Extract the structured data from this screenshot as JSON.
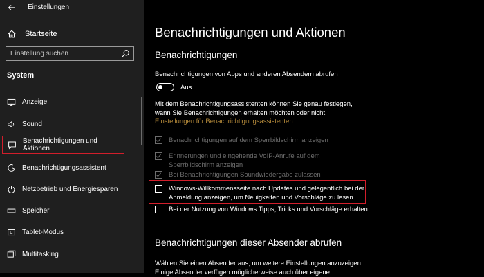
{
  "window": {
    "title": "Einstellungen",
    "back_icon": "back-arrow-icon"
  },
  "sidebar": {
    "home_label": "Startseite",
    "search_placeholder": "Einstellung suchen",
    "section": "System",
    "items": [
      {
        "label": "Anzeige",
        "icon": "monitor-icon"
      },
      {
        "label": "Sound",
        "icon": "speaker-icon"
      },
      {
        "label": "Benachrichtigungen und Aktionen",
        "icon": "notification-icon",
        "selected": true
      },
      {
        "label": "Benachrichtigungsassistent",
        "icon": "moon-icon"
      },
      {
        "label": "Netzbetrieb und Energiesparen",
        "icon": "power-icon"
      },
      {
        "label": "Speicher",
        "icon": "storage-icon"
      },
      {
        "label": "Tablet-Modus",
        "icon": "tablet-icon"
      },
      {
        "label": "Multitasking",
        "icon": "multitasking-icon"
      }
    ]
  },
  "main": {
    "title": "Benachrichtigungen und Aktionen",
    "section1_heading": "Benachrichtigungen",
    "toggle_label": "Benachrichtigungen von Apps und anderen Absendern abrufen",
    "toggle_state": "Aus",
    "description_line1": "Mit dem Benachrichtigungsassistenten können Sie genau festlegen,",
    "description_line2": "wann Sie Benachrichtigungen erhalten möchten oder nicht.",
    "assistant_link": "Einstellungen für Benachrichtigungsassistenten",
    "checkboxes": [
      {
        "line1": "Benachrichtigungen auf dem Sperrbildschirm anzeigen",
        "line2": "",
        "checked": true,
        "disabled": true
      },
      {
        "line1": "Erinnerungen und eingehende VoIP-Anrufe auf dem",
        "line2": "Sperrbildschirm anzeigen",
        "checked": true,
        "disabled": true
      },
      {
        "line1": "Bei Benachrichtigungen Soundwiedergabe zulassen",
        "line2": "",
        "checked": true,
        "disabled": true
      },
      {
        "line1": "Windows-Willkommensseite nach Updates und gelegentlich bei der",
        "line2": "Anmeldung anzeigen, um Neuigkeiten und Vorschläge zu lesen",
        "checked": false,
        "disabled": false
      },
      {
        "line1": "Bei der Nutzung von Windows Tipps, Tricks und Vorschläge erhalten",
        "line2": "",
        "checked": false,
        "disabled": false
      }
    ],
    "section2_heading": "Benachrichtigungen dieser Absender abrufen",
    "section2_line1": "Wählen Sie einen Absender aus, um weitere Einstellungen anzuzeigen.",
    "section2_line2": "Einige Absender verfügen möglicherweise auch über eigene"
  },
  "colors": {
    "sidebar_bg": "#1f1f1f",
    "main_bg": "#000000",
    "highlight": "#d21e2b",
    "link": "#b58a3a",
    "disabled": "#6d6d6d"
  }
}
